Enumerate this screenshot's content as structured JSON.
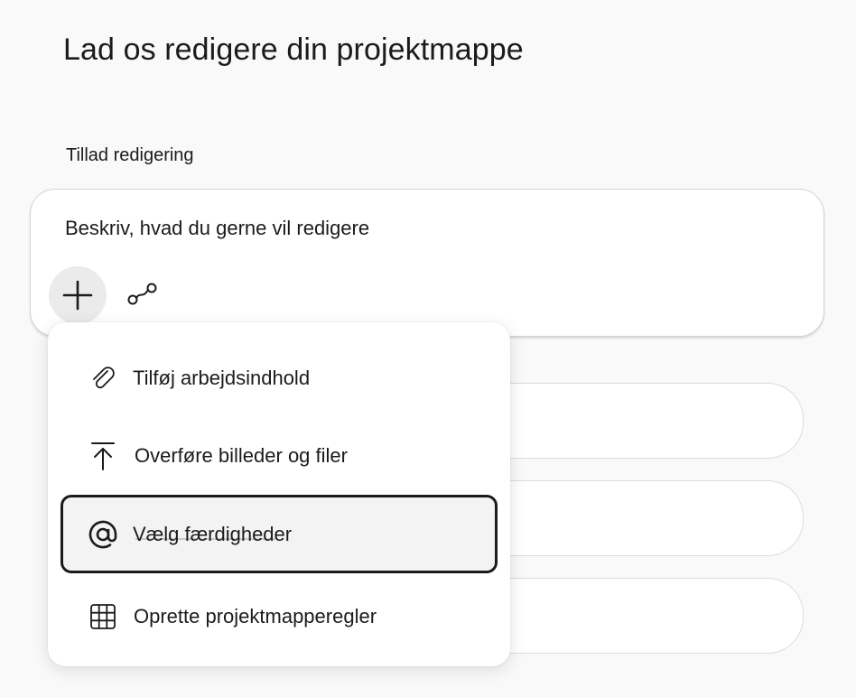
{
  "page": {
    "title": "Lad os redigere din projektmappe",
    "section_label": "Tillad redigering"
  },
  "prompt": {
    "placeholder": "Beskriv, hvad du gerne vil redigere",
    "add_icon": "plus-icon",
    "link_icon": "link-chain-icon"
  },
  "menu": {
    "items": [
      {
        "label": "Tilføj arbejdsindhold",
        "icon": "paperclip-icon"
      },
      {
        "label": "Overføre billeder og filer",
        "icon": "upload-icon"
      },
      {
        "label": "Vælg færdigheder",
        "icon": "at-sign-icon"
      },
      {
        "label": "Oprette projektmapperegler",
        "icon": "grid-icon"
      }
    ],
    "focused_index": 2
  },
  "colors": {
    "background": "#f9f9f9",
    "surface": "#ffffff",
    "text": "#1b1b1b",
    "focus_border": "#1b1b1b"
  }
}
